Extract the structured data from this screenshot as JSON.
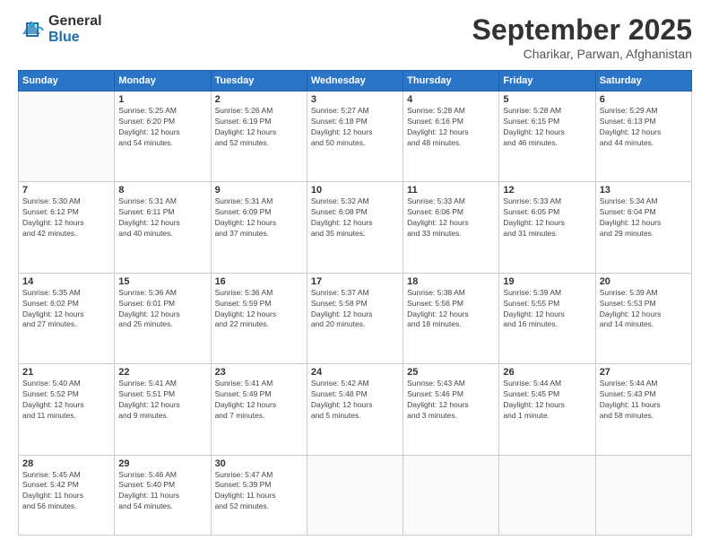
{
  "logo": {
    "general": "General",
    "blue": "Blue"
  },
  "title": "September 2025",
  "location": "Charikar, Parwan, Afghanistan",
  "days_of_week": [
    "Sunday",
    "Monday",
    "Tuesday",
    "Wednesday",
    "Thursday",
    "Friday",
    "Saturday"
  ],
  "weeks": [
    [
      {
        "day": "",
        "info": ""
      },
      {
        "day": "1",
        "info": "Sunrise: 5:25 AM\nSunset: 6:20 PM\nDaylight: 12 hours\nand 54 minutes."
      },
      {
        "day": "2",
        "info": "Sunrise: 5:26 AM\nSunset: 6:19 PM\nDaylight: 12 hours\nand 52 minutes."
      },
      {
        "day": "3",
        "info": "Sunrise: 5:27 AM\nSunset: 6:18 PM\nDaylight: 12 hours\nand 50 minutes."
      },
      {
        "day": "4",
        "info": "Sunrise: 5:28 AM\nSunset: 6:16 PM\nDaylight: 12 hours\nand 48 minutes."
      },
      {
        "day": "5",
        "info": "Sunrise: 5:28 AM\nSunset: 6:15 PM\nDaylight: 12 hours\nand 46 minutes."
      },
      {
        "day": "6",
        "info": "Sunrise: 5:29 AM\nSunset: 6:13 PM\nDaylight: 12 hours\nand 44 minutes."
      }
    ],
    [
      {
        "day": "7",
        "info": "Sunrise: 5:30 AM\nSunset: 6:12 PM\nDaylight: 12 hours\nand 42 minutes."
      },
      {
        "day": "8",
        "info": "Sunrise: 5:31 AM\nSunset: 6:11 PM\nDaylight: 12 hours\nand 40 minutes."
      },
      {
        "day": "9",
        "info": "Sunrise: 5:31 AM\nSunset: 6:09 PM\nDaylight: 12 hours\nand 37 minutes."
      },
      {
        "day": "10",
        "info": "Sunrise: 5:32 AM\nSunset: 6:08 PM\nDaylight: 12 hours\nand 35 minutes."
      },
      {
        "day": "11",
        "info": "Sunrise: 5:33 AM\nSunset: 6:06 PM\nDaylight: 12 hours\nand 33 minutes."
      },
      {
        "day": "12",
        "info": "Sunrise: 5:33 AM\nSunset: 6:05 PM\nDaylight: 12 hours\nand 31 minutes."
      },
      {
        "day": "13",
        "info": "Sunrise: 5:34 AM\nSunset: 6:04 PM\nDaylight: 12 hours\nand 29 minutes."
      }
    ],
    [
      {
        "day": "14",
        "info": "Sunrise: 5:35 AM\nSunset: 6:02 PM\nDaylight: 12 hours\nand 27 minutes."
      },
      {
        "day": "15",
        "info": "Sunrise: 5:36 AM\nSunset: 6:01 PM\nDaylight: 12 hours\nand 25 minutes."
      },
      {
        "day": "16",
        "info": "Sunrise: 5:36 AM\nSunset: 5:59 PM\nDaylight: 12 hours\nand 22 minutes."
      },
      {
        "day": "17",
        "info": "Sunrise: 5:37 AM\nSunset: 5:58 PM\nDaylight: 12 hours\nand 20 minutes."
      },
      {
        "day": "18",
        "info": "Sunrise: 5:38 AM\nSunset: 5:56 PM\nDaylight: 12 hours\nand 18 minutes."
      },
      {
        "day": "19",
        "info": "Sunrise: 5:39 AM\nSunset: 5:55 PM\nDaylight: 12 hours\nand 16 minutes."
      },
      {
        "day": "20",
        "info": "Sunrise: 5:39 AM\nSunset: 5:53 PM\nDaylight: 12 hours\nand 14 minutes."
      }
    ],
    [
      {
        "day": "21",
        "info": "Sunrise: 5:40 AM\nSunset: 5:52 PM\nDaylight: 12 hours\nand 11 minutes."
      },
      {
        "day": "22",
        "info": "Sunrise: 5:41 AM\nSunset: 5:51 PM\nDaylight: 12 hours\nand 9 minutes."
      },
      {
        "day": "23",
        "info": "Sunrise: 5:41 AM\nSunset: 5:49 PM\nDaylight: 12 hours\nand 7 minutes."
      },
      {
        "day": "24",
        "info": "Sunrise: 5:42 AM\nSunset: 5:48 PM\nDaylight: 12 hours\nand 5 minutes."
      },
      {
        "day": "25",
        "info": "Sunrise: 5:43 AM\nSunset: 5:46 PM\nDaylight: 12 hours\nand 3 minutes."
      },
      {
        "day": "26",
        "info": "Sunrise: 5:44 AM\nSunset: 5:45 PM\nDaylight: 12 hours\nand 1 minute."
      },
      {
        "day": "27",
        "info": "Sunrise: 5:44 AM\nSunset: 5:43 PM\nDaylight: 11 hours\nand 58 minutes."
      }
    ],
    [
      {
        "day": "28",
        "info": "Sunrise: 5:45 AM\nSunset: 5:42 PM\nDaylight: 11 hours\nand 56 minutes."
      },
      {
        "day": "29",
        "info": "Sunrise: 5:46 AM\nSunset: 5:40 PM\nDaylight: 11 hours\nand 54 minutes."
      },
      {
        "day": "30",
        "info": "Sunrise: 5:47 AM\nSunset: 5:39 PM\nDaylight: 11 hours\nand 52 minutes."
      },
      {
        "day": "",
        "info": ""
      },
      {
        "day": "",
        "info": ""
      },
      {
        "day": "",
        "info": ""
      },
      {
        "day": "",
        "info": ""
      }
    ]
  ]
}
